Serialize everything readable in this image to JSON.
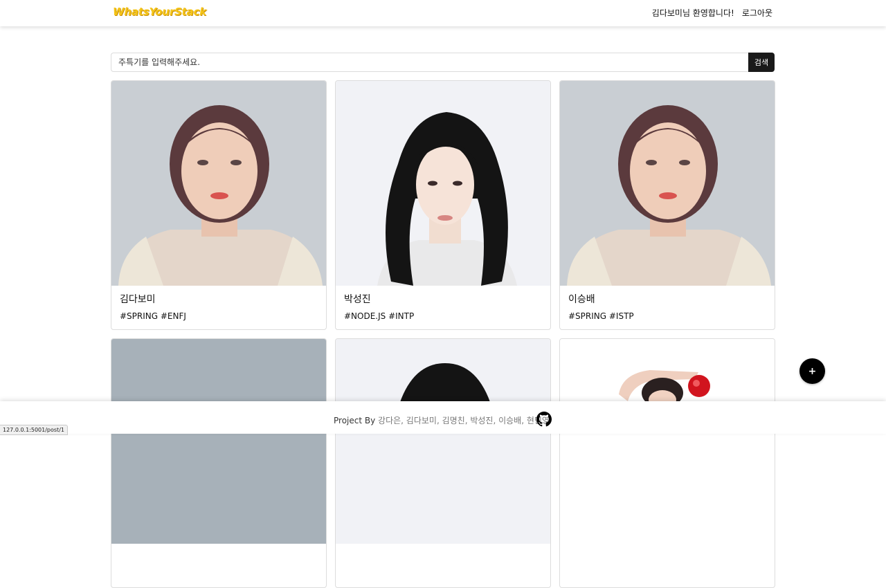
{
  "navbar": {
    "brand": "WhatsYourStack",
    "welcome": "김다보미님 환영합니다!",
    "logout": "로그아웃"
  },
  "search": {
    "placeholder": "주특기를 입력해주세요.",
    "button_label": "검색"
  },
  "cards": [
    {
      "name": "김다보미",
      "tags": "#SPRING #ENFJ"
    },
    {
      "name": "박성진",
      "tags": "#NODE.JS #INTP"
    },
    {
      "name": "이승배",
      "tags": "#SPRING #ISTP"
    },
    {
      "name": "",
      "tags": ""
    },
    {
      "name": "",
      "tags": ""
    },
    {
      "name": "",
      "tags": ""
    }
  ],
  "footer": {
    "prefix": "Project By ",
    "names": "강다은, 김다보미, 김명친, 박성진, 이승배, 현민영"
  },
  "fab": {
    "label": "+"
  },
  "status_bar": {
    "url": "127.0.0.1:5001/post/1"
  },
  "colors": {
    "brand": "#f5c518",
    "search_button": "#1a1a1a"
  }
}
